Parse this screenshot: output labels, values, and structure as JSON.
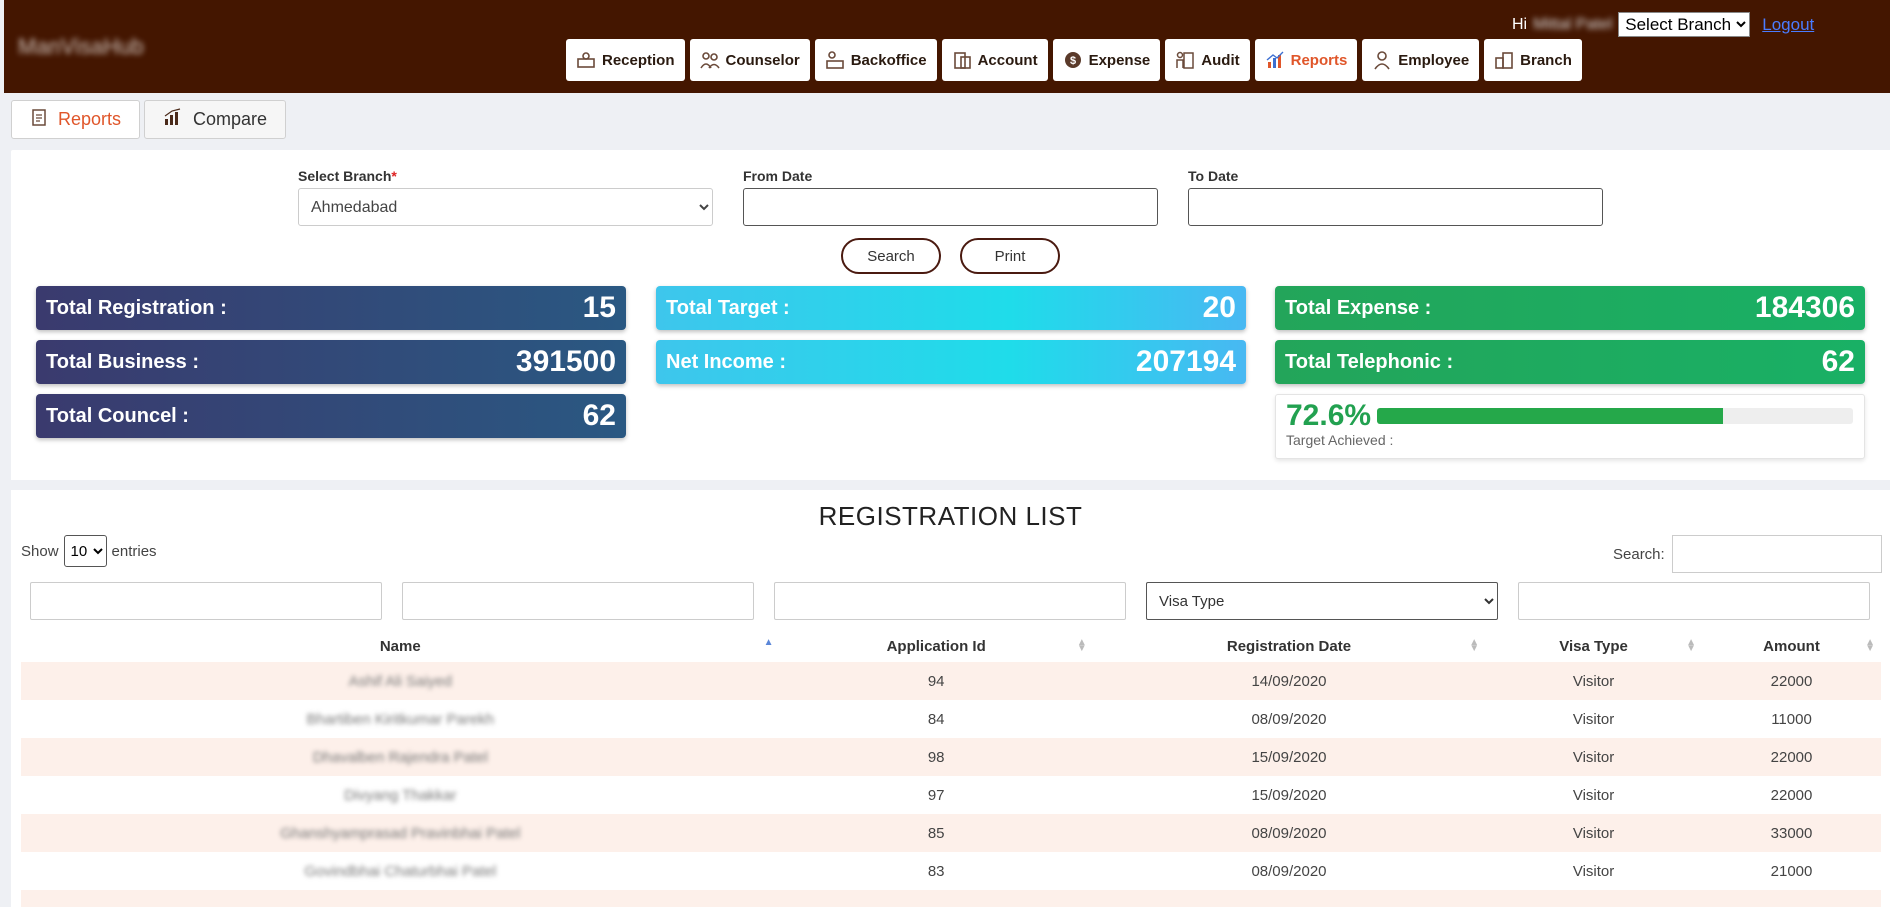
{
  "header": {
    "brand": "ManVisaHub",
    "greeting": "Hi",
    "user_name": "Mittal Patel",
    "branch_select": "Select Branch",
    "logout": "Logout"
  },
  "nav": [
    {
      "label": "Reception",
      "icon": "reception-icon"
    },
    {
      "label": "Counselor",
      "icon": "counselor-icon"
    },
    {
      "label": "Backoffice",
      "icon": "backoffice-icon"
    },
    {
      "label": "Account",
      "icon": "account-icon"
    },
    {
      "label": "Expense",
      "icon": "expense-icon"
    },
    {
      "label": "Audit",
      "icon": "audit-icon"
    },
    {
      "label": "Reports",
      "icon": "reports-icon"
    },
    {
      "label": "Employee",
      "icon": "employee-icon"
    },
    {
      "label": "Branch",
      "icon": "branch-icon"
    }
  ],
  "tabs": [
    {
      "label": "Reports"
    },
    {
      "label": "Compare"
    }
  ],
  "filters": {
    "branch_label": "Select Branch",
    "branch_required": "*",
    "branch_value": "Ahmedabad",
    "from_label": "From Date",
    "from_value": "",
    "to_label": "To Date",
    "to_value": "",
    "search_button": "Search",
    "print_button": "Print"
  },
  "stats": {
    "registration": {
      "label": "Total Registration :",
      "value": "15"
    },
    "business": {
      "label": "Total Business :",
      "value": "391500"
    },
    "councel": {
      "label": "Total Councel :",
      "value": "62"
    },
    "target": {
      "label": "Total Target :",
      "value": "20"
    },
    "net_income": {
      "label": "Net Income :",
      "value": "207194"
    },
    "expense": {
      "label": "Total Expense :",
      "value": "184306"
    },
    "telephonic": {
      "label": "Total Telephonic :",
      "value": "62"
    }
  },
  "achievement": {
    "percent_text": "72.6%",
    "percent": 72.6,
    "caption": "Target Achieved :"
  },
  "colors": {
    "header": "#441600",
    "accent": "#e0562a",
    "progress": "#25a84a"
  },
  "list": {
    "title": "REGISTRATION LIST",
    "show_label": "Show",
    "entries_value": "10",
    "entries_label": "entries",
    "search_label": "Search:",
    "visa_type_filter": "Visa Type",
    "columns": [
      "Name",
      "Application Id",
      "Registration Date",
      "Visa Type",
      "Amount"
    ],
    "rows": [
      {
        "name": "Ashif Ali Saiyed",
        "id": "94",
        "date": "14/09/2020",
        "visa": "Visitor",
        "amount": "22000"
      },
      {
        "name": "Bhartiben Kiritkumar Parekh",
        "id": "84",
        "date": "08/09/2020",
        "visa": "Visitor",
        "amount": "11000"
      },
      {
        "name": "Dhavalben Rajendra Patel",
        "id": "98",
        "date": "15/09/2020",
        "visa": "Visitor",
        "amount": "22000"
      },
      {
        "name": "Divyang Thakkar",
        "id": "97",
        "date": "15/09/2020",
        "visa": "Visitor",
        "amount": "22000"
      },
      {
        "name": "Ghanshyamprasad Pravinbhai Patel",
        "id": "85",
        "date": "08/09/2020",
        "visa": "Visitor",
        "amount": "33000"
      },
      {
        "name": "Govindbhai Chaturbhai Patel",
        "id": "83",
        "date": "08/09/2020",
        "visa": "Visitor",
        "amount": "21000"
      }
    ]
  }
}
